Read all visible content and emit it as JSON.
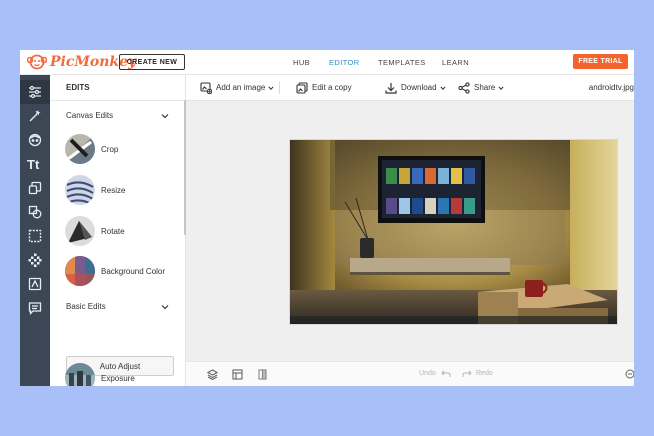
{
  "brand": {
    "name": "PicMonkey",
    "color": "#f36b3c"
  },
  "topnav": {
    "create_label": "CREATE NEW",
    "links": [
      "HUB",
      "EDITOR",
      "TEMPLATES",
      "LEARN"
    ],
    "active_link": "EDITOR",
    "trial_label": "FREE TRIAL"
  },
  "rail": {
    "icons": [
      "sliders-icon",
      "magic-wand-icon",
      "face-icon",
      "text-icon",
      "graphics-icon",
      "texture-icon",
      "frame-icon",
      "pattern-icon",
      "touch-up-icon",
      "comments-icon"
    ]
  },
  "panel": {
    "title": "EDITS",
    "canvas_edits_label": "Canvas Edits",
    "canvas_tools": [
      {
        "label": "Crop",
        "icon": "crop-thumbnail"
      },
      {
        "label": "Resize",
        "icon": "resize-thumbnail"
      },
      {
        "label": "Rotate",
        "icon": "rotate-thumbnail"
      },
      {
        "label": "Background Color",
        "icon": "background-color-thumbnail"
      }
    ],
    "basic_edits_label": "Basic Edits",
    "auto_adjust_label": "Auto Adjust",
    "exposure_label": "Exposure"
  },
  "toolbar": {
    "add_image_label": "Add an image",
    "edit_copy_label": "Edit a copy",
    "download_label": "Download",
    "share_label": "Share",
    "filename": "androidtv.jpg"
  },
  "bottombar": {
    "undo_label": "Undo",
    "redo_label": "Redo"
  }
}
